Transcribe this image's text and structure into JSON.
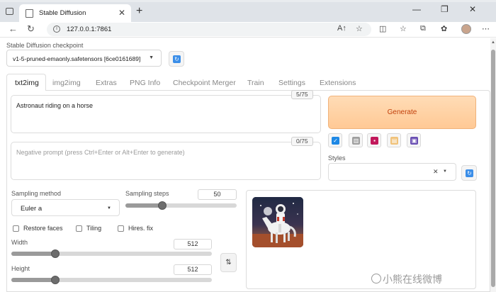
{
  "browser": {
    "tab_title": "Stable Diffusion",
    "tab_close": "✕",
    "new_tab": "+",
    "window_controls": {
      "minimize": "—",
      "restore": "❐",
      "close": "✕"
    },
    "url": "127.0.0.1:7861",
    "nav": {
      "back": "←",
      "reload": "↻"
    },
    "url_icons": [
      "A↑",
      "☆"
    ],
    "toolbar_icons": [
      "split-screen-icon",
      "favorites-icon",
      "collections-icon",
      "extensions-icon",
      "profile-avatar",
      "more-icon"
    ]
  },
  "checkpoint": {
    "label": "Stable Diffusion checkpoint",
    "value": "v1-5-pruned-emaonly.safetensors [6ce0161689]",
    "arrow": "▼"
  },
  "tabs": [
    {
      "label": "txt2img",
      "active": true
    },
    {
      "label": "img2img",
      "active": false
    },
    {
      "label": "Extras",
      "active": false
    },
    {
      "label": "PNG Info",
      "active": false
    },
    {
      "label": "Checkpoint Merger",
      "active": false
    },
    {
      "label": "Train",
      "active": false
    },
    {
      "label": "Settings",
      "active": false
    },
    {
      "label": "Extensions",
      "active": false
    }
  ],
  "prompt": {
    "value": "Astronaut riding on a horse",
    "counter": "5/75"
  },
  "negative_prompt": {
    "placeholder": "Negative prompt (press Ctrl+Enter or Alt+Enter to generate)",
    "counter": "0/75"
  },
  "generate": {
    "label": "Generate"
  },
  "tool_buttons": [
    {
      "name": "read-params-icon",
      "glyph": "↙",
      "color": "#1e88e5"
    },
    {
      "name": "trash-icon",
      "glyph": "🗑",
      "color": "#9e9e9e"
    },
    {
      "name": "extra-networks-icon",
      "glyph": "▣",
      "color": "#c2185b"
    },
    {
      "name": "clipboard-icon",
      "glyph": "📋",
      "color": "#f0c27a"
    },
    {
      "name": "save-style-icon",
      "glyph": "💾",
      "color": "#6a4fb3"
    }
  ],
  "styles": {
    "label": "Styles",
    "clear": "✕",
    "arrow": "▼"
  },
  "sampling_method": {
    "label": "Sampling method",
    "value": "Euler a",
    "arrow": "▼"
  },
  "sampling_steps": {
    "label": "Sampling steps",
    "value": "50",
    "fraction": 0.33
  },
  "checkboxes": [
    {
      "label": "Restore faces",
      "checked": false
    },
    {
      "label": "Tiling",
      "checked": false
    },
    {
      "label": "Hires. fix",
      "checked": false
    }
  ],
  "width": {
    "label": "Width",
    "value": "512",
    "fraction": 0.22
  },
  "height": {
    "label": "Height",
    "value": "512",
    "fraction": 0.22
  },
  "swap_glyph": "⇅",
  "watermark": "小熊在线微博"
}
